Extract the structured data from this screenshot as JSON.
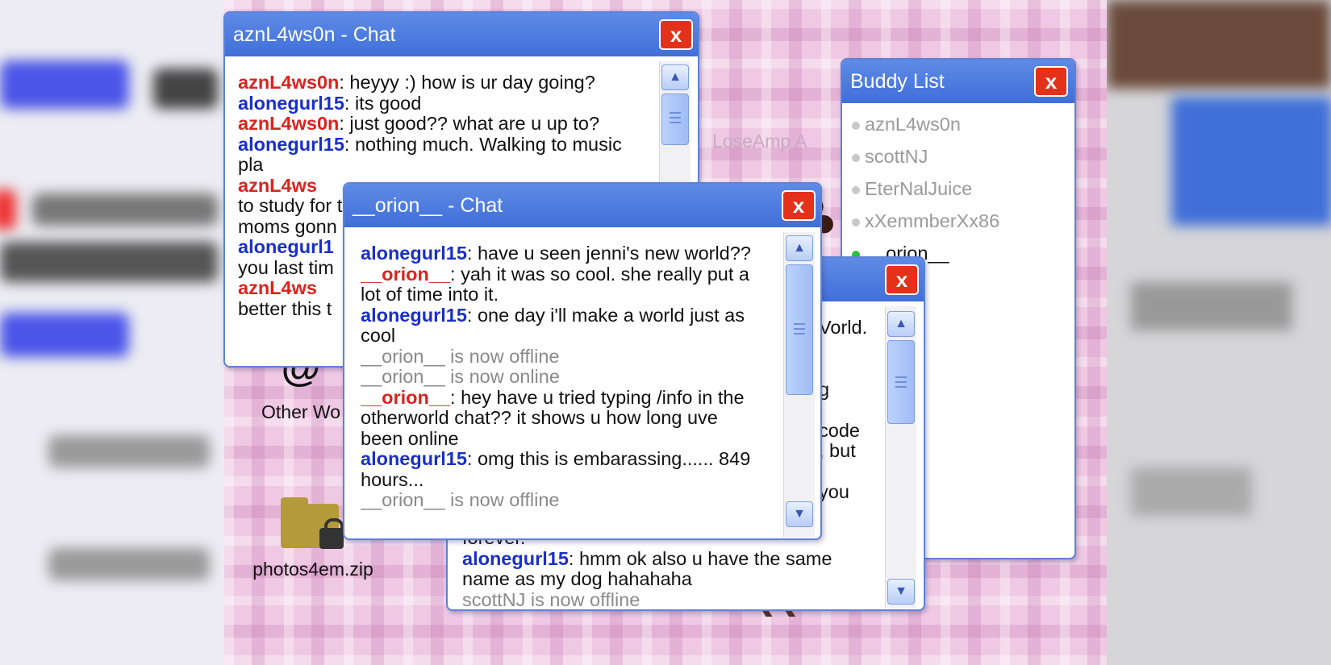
{
  "desktop": {
    "icons": [
      {
        "label": "Other Wo",
        "icon": "otherworld-logo-icon"
      },
      {
        "label": "photos4em.zip",
        "icon": "locked-folder-icon"
      }
    ],
    "faded_label": "LoseAmp A"
  },
  "windows": {
    "chat_azn": {
      "title": "aznL4ws0n - Chat",
      "close_label": "x",
      "messages": [
        {
          "user": "aznL4ws0n",
          "text": ": heyyy :) how is ur day going?"
        },
        {
          "user": "alonegurl15",
          "text": ": its good"
        },
        {
          "user": "aznL4ws0n",
          "text": ": just good?? what are u up to?"
        },
        {
          "user": "alonegurl15",
          "text": ": nothing much. Walking to music pla"
        },
        {
          "user": "aznL4ws",
          "text": "to study for th"
        },
        {
          "user": "",
          "text": "moms gonn"
        },
        {
          "user": "alonegurl1",
          "text": ""
        },
        {
          "user": "",
          "text": "you last tim"
        },
        {
          "user": "aznL4ws",
          "text": ""
        },
        {
          "user": "",
          "text": "better this t"
        }
      ]
    },
    "chat_orion": {
      "title": "__orion__ - Chat",
      "close_label": "x",
      "messages": [
        {
          "user": "alonegurl15",
          "text": ": have u seen jenni's new world??"
        },
        {
          "user": "__orion__",
          "text": ": yah it was so cool. she really put a lot of time into it."
        },
        {
          "user": "alonegurl15",
          "text": ": one day i'll make a world just as cool"
        },
        {
          "system": "__orion__ is now offline"
        },
        {
          "system": "__orion__ is now online"
        },
        {
          "user": "__orion__",
          "text": ": hey have u tried typing /info in the otherworld chat?? it shows u how long uve been online"
        },
        {
          "user": "alonegurl15",
          "text": ": omg this is embarassing...... 849 hours..."
        },
        {
          "system": "__orion__ is now offline"
        }
      ]
    },
    "chat_third": {
      "close_label": "x",
      "fragments": [
        "Vorld.",
        "",
        "g",
        "",
        "code",
        ", but",
        "",
        "you"
      ],
      "messages": [
        {
          "text": "forever."
        },
        {
          "user": "alonegurl15",
          "text": ": hmm ok also u have the same name as my dog hahahaha"
        },
        {
          "system": "scottNJ is now offline"
        }
      ]
    },
    "buddy_list": {
      "title": "Buddy List",
      "close_label": "x",
      "buddies": [
        {
          "name": "aznL4ws0n",
          "online": false
        },
        {
          "name": "scottNJ",
          "online": false
        },
        {
          "name": "EterNalJuice",
          "online": false
        },
        {
          "name": "xXemmberXx86",
          "online": false
        },
        {
          "name": "__orion__",
          "online": true
        }
      ]
    }
  },
  "colors": {
    "title_blue": "#3f6fd8",
    "close_red": "#e4321a",
    "user_red": "#d8241f",
    "user_blue": "#1a2fc8",
    "system_grey": "#8a8a8a"
  }
}
